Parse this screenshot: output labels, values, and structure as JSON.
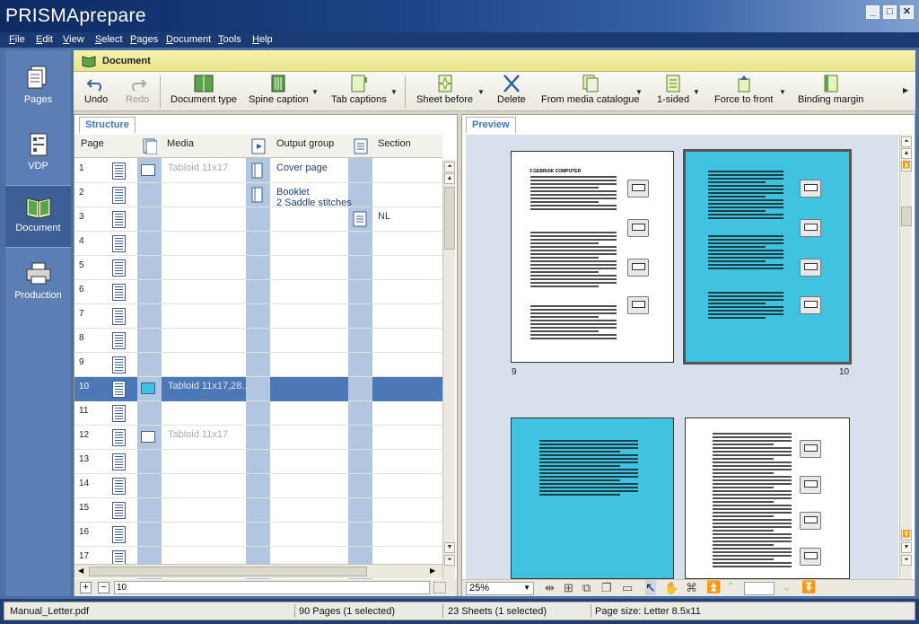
{
  "app": {
    "title": "PRISMAprepare"
  },
  "menu": [
    "File",
    "Edit",
    "View",
    "Select",
    "Pages",
    "Document",
    "Tools",
    "Help"
  ],
  "nav": [
    {
      "label": "Pages",
      "icon": "pages-icon",
      "selected": false
    },
    {
      "label": "VDP",
      "icon": "vdp-icon",
      "selected": false
    },
    {
      "label": "Document",
      "icon": "book-icon",
      "selected": true
    },
    {
      "label": "Production",
      "icon": "printer-icon",
      "selected": false
    }
  ],
  "panel": {
    "title": "Document"
  },
  "toolbar": {
    "undo": "Undo",
    "redo": "Redo",
    "document_type": "Document type",
    "spine_caption": "Spine caption",
    "tab_captions": "Tab captions",
    "sheet_before": "Sheet before",
    "delete": "Delete",
    "from_media_catalogue": "From media catalogue",
    "sided": "1-sided",
    "force_to_front": "Force to front",
    "binding_margin": "Binding margin"
  },
  "structure": {
    "tab": "Structure",
    "headers": {
      "page": "Page",
      "media": "Media",
      "output_group": "Output group",
      "section": "Section"
    },
    "rows": [
      {
        "page": "1",
        "media": "Tabloid 11x17",
        "group": "Cover page",
        "section": ""
      },
      {
        "page": "2",
        "media": "",
        "group": "Booklet",
        "group2": "2 Saddle stitches",
        "section": ""
      },
      {
        "page": "3",
        "media": "",
        "group": "",
        "section": "NL"
      },
      {
        "page": "4"
      },
      {
        "page": "5"
      },
      {
        "page": "6"
      },
      {
        "page": "7"
      },
      {
        "page": "8"
      },
      {
        "page": "9"
      },
      {
        "page": "10",
        "media": "Tabloid 11x17,28...",
        "selected": true
      },
      {
        "page": "11"
      },
      {
        "page": "12",
        "media": "Tabloid 11x17"
      },
      {
        "page": "13"
      },
      {
        "page": "14"
      },
      {
        "page": "15"
      },
      {
        "page": "16"
      },
      {
        "page": "17"
      }
    ],
    "search_value": "10"
  },
  "preview": {
    "tab": "Preview",
    "page_left": "9",
    "page_right": "10",
    "zoom": "25%",
    "page_heading": "3    GEBRUIK COMPUTER"
  },
  "status": {
    "file": "Manual_Letter.pdf",
    "pages": "90 Pages (1 selected)",
    "sheets": "23 Sheets (1 selected)",
    "page_size": "Page size: Letter 8.5x11"
  },
  "colors": {
    "accent": "#3fc3e0",
    "selection": "#4c78b7",
    "frame": "#1f3c74"
  }
}
